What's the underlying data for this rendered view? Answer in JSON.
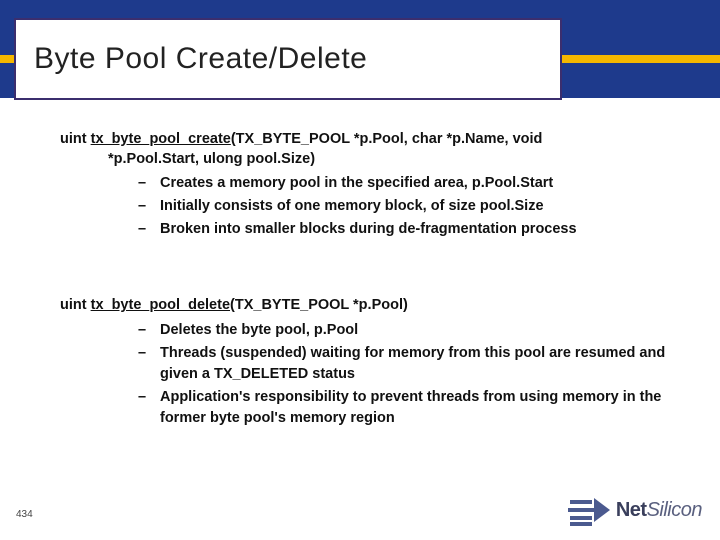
{
  "slide": {
    "title": "Byte Pool Create/Delete",
    "page_number": "434"
  },
  "create": {
    "return_type": "uint ",
    "fn_name": "tx_byte_pool_create",
    "params1": "(TX_BYTE_POOL *p.Pool, char *p.Name, void",
    "params2": "*p.Pool.Start, ulong pool.Size)",
    "b1": "Creates a memory pool in the specified area, p.Pool.Start",
    "b2": "Initially consists of one memory block, of size pool.Size",
    "b3": "Broken into smaller blocks during de-fragmentation process"
  },
  "delete": {
    "return_type": "uint ",
    "fn_name": "tx_byte_pool_delete",
    "params1": "(TX_BYTE_POOL *p.Pool)",
    "b1": "Deletes the byte pool, p.Pool",
    "b2": "Threads (suspended) waiting for memory from this pool are resumed and given a TX_DELETED status",
    "b3": "Application's responsibility to prevent threads from using memory in the former byte pool's memory region"
  },
  "logo": {
    "name_a": "Net",
    "name_b": "Silicon"
  }
}
